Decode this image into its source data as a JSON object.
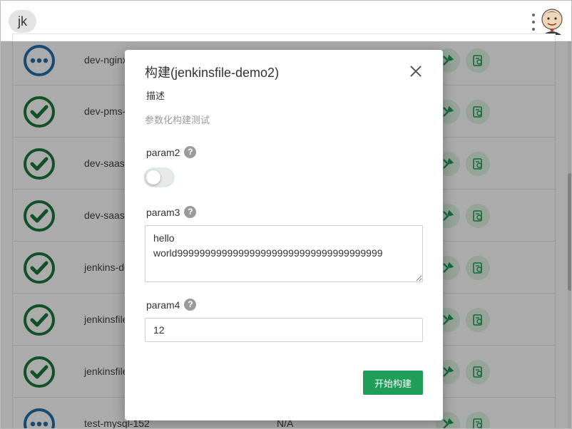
{
  "header": {
    "user_initials": "jk",
    "menu_icon": "kebab-menu-icon",
    "logo_icon": "jenkins-logo-icon"
  },
  "jobs": [
    {
      "status": "running",
      "name": "dev-nginx",
      "extra": ""
    },
    {
      "status": "success",
      "name": "dev-pms-",
      "extra": ""
    },
    {
      "status": "success",
      "name": "dev-saas-",
      "extra": ""
    },
    {
      "status": "success",
      "name": "dev-saas",
      "extra": ""
    },
    {
      "status": "success",
      "name": "jenkins-de",
      "extra": ""
    },
    {
      "status": "success",
      "name": "jenkinsfile",
      "extra": ""
    },
    {
      "status": "success",
      "name": "jenkinsfile",
      "extra": ""
    },
    {
      "status": "running",
      "name": "test-mysql-152",
      "extra": "N/A"
    }
  ],
  "dialog": {
    "title": "构建(jenkinsfile-demo2)",
    "description_label": "描述",
    "description": "参数化构建测试",
    "param2": {
      "label": "param2",
      "value": false
    },
    "param3": {
      "label": "param3",
      "value": "hello\nworld9999999999999999999999999999999999999"
    },
    "param4": {
      "label": "param4",
      "value": "12"
    },
    "help_symbol": "?",
    "submit_label": "开始构建"
  },
  "colors": {
    "accent": "#1e9e58",
    "success": "#1b7a3d",
    "running": "#1f6fad"
  }
}
